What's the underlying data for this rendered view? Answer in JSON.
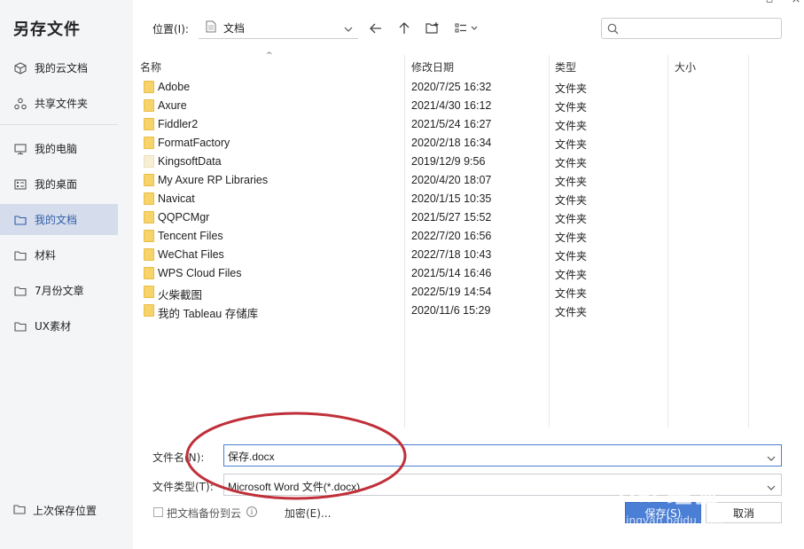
{
  "dialog": {
    "title": "另存文件"
  },
  "sidebar": {
    "items": [
      {
        "label": "我的云文档"
      },
      {
        "label": "共享文件夹"
      },
      {
        "label": "我的电脑"
      },
      {
        "label": "我的桌面"
      },
      {
        "label": "我的文档",
        "active": true
      },
      {
        "label": "材料"
      },
      {
        "label": "7月份文章"
      },
      {
        "label": "UX素材"
      }
    ],
    "last_save": "上次保存位置"
  },
  "toolbar": {
    "location_label": "位置(I):",
    "location_value": "文档",
    "search_placeholder": ""
  },
  "columns": {
    "name": "名称",
    "date": "修改日期",
    "type": "类型",
    "size": "大小"
  },
  "files": [
    {
      "name": "Adobe",
      "date": "2020/7/25 16:32",
      "type": "文件夹"
    },
    {
      "name": "Axure",
      "date": "2021/4/30 16:12",
      "type": "文件夹"
    },
    {
      "name": "Fiddler2",
      "date": "2021/5/24 16:27",
      "type": "文件夹"
    },
    {
      "name": "FormatFactory",
      "date": "2020/2/18 16:34",
      "type": "文件夹"
    },
    {
      "name": "KingsoftData",
      "date": "2019/12/9 9:56",
      "type": "文件夹"
    },
    {
      "name": "My Axure RP Libraries",
      "date": "2020/4/20 18:07",
      "type": "文件夹"
    },
    {
      "name": "Navicat",
      "date": "2020/1/15 10:35",
      "type": "文件夹"
    },
    {
      "name": "QQPCMgr",
      "date": "2021/5/27 15:52",
      "type": "文件夹"
    },
    {
      "name": "Tencent Files",
      "date": "2022/7/20 16:56",
      "type": "文件夹"
    },
    {
      "name": "WeChat Files",
      "date": "2022/7/18 10:43",
      "type": "文件夹"
    },
    {
      "name": "WPS Cloud Files",
      "date": "2021/5/14 16:46",
      "type": "文件夹"
    },
    {
      "name": "火柴截图",
      "date": "2022/5/19 14:54",
      "type": "文件夹"
    },
    {
      "name": "我的 Tableau 存储库",
      "date": "2020/11/6 15:29",
      "type": "文件夹"
    }
  ],
  "form": {
    "filename_label": "文件名(N):",
    "filename_value": "保存.docx",
    "filetype_label": "文件类型(T):",
    "filetype_value": "Microsoft Word 文件(*.docx)",
    "backup_label": "把文档备份到云",
    "encrypt_label": "加密(E)...",
    "save_label": "保存(S)",
    "cancel_label": "取消"
  },
  "watermark": {
    "brand": "Bai 经验",
    "url": "jingyan.baidu.com"
  },
  "colors": {
    "accent": "#4b7fd6",
    "folder": "#f7d46b",
    "annotation": "#c0303a",
    "sidebar_bg": "#f4f5f7",
    "active_bg": "#d5dceb"
  }
}
